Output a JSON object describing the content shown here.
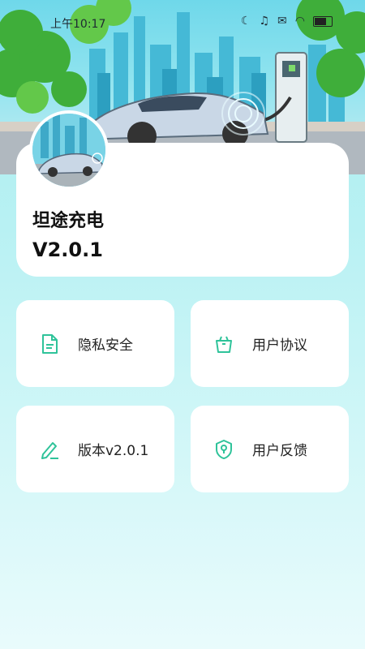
{
  "status_bar": {
    "time": "上午10:17",
    "icons": [
      "moon-icon",
      "mute-icon",
      "mail-icon",
      "wifi-icon",
      "battery-icon"
    ]
  },
  "app": {
    "name": "坦途充电",
    "version": "V2.0.1"
  },
  "tiles": [
    {
      "label": "隐私安全",
      "icon": "document-icon"
    },
    {
      "label": "用户协议",
      "icon": "basket-icon"
    },
    {
      "label": "版本v2.0.1",
      "icon": "pen-icon"
    },
    {
      "label": "用户反馈",
      "icon": "shield-location-icon"
    }
  ],
  "colors": {
    "accent": "#2fc39a",
    "background_top": "#a9eef0",
    "background_bottom": "#e9fbfc"
  }
}
